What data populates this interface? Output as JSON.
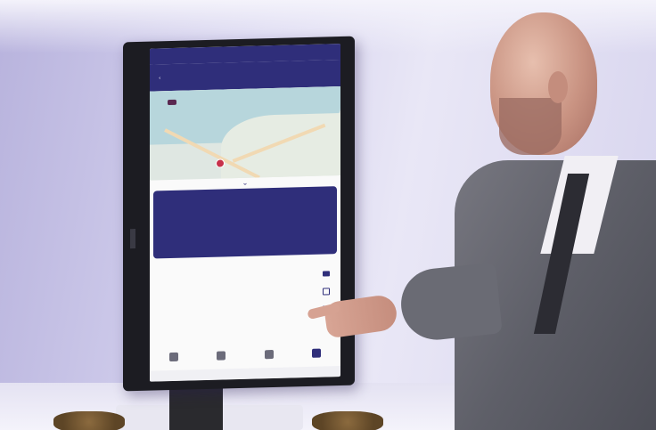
{
  "screen": {
    "status_bar": {
      "left": "",
      "right": ""
    },
    "app_bar": {
      "title": ""
    },
    "info_card": {
      "title": "",
      "subtitle": "",
      "body": ""
    },
    "section_title": "",
    "list_items": [
      {
        "label": "",
        "color": "#c7a000"
      },
      {
        "label": "",
        "color": "#c7314a"
      },
      {
        "label": "",
        "color": "#8a2f8e"
      }
    ]
  },
  "colors": {
    "app_primary": "#2f2e7a",
    "wall": "#c9c6e6",
    "suit": "#5e5f68"
  }
}
